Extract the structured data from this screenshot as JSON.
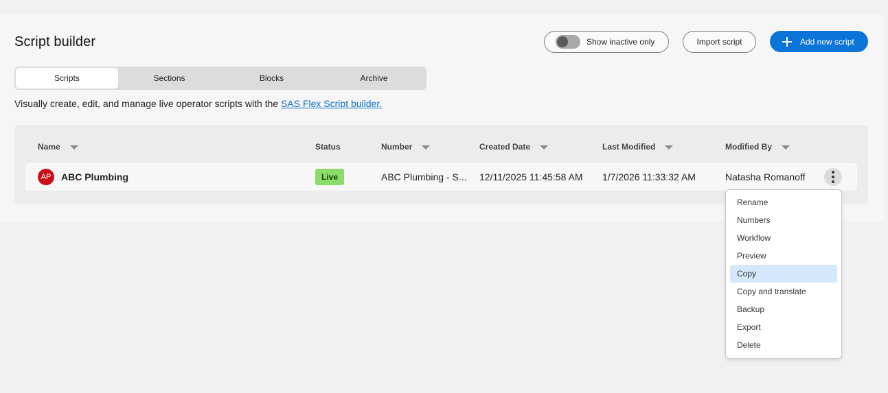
{
  "page": {
    "title": "Script builder",
    "description": "Visually create, edit, and manage live operator scripts with the ",
    "description_link": "SAS Flex Script builder."
  },
  "header": {
    "toggle_label": "Show inactive only",
    "toggle_on": false,
    "import_label": "Import script",
    "add_label": "Add new script"
  },
  "tabs": [
    {
      "label": "Scripts",
      "active": true
    },
    {
      "label": "Sections",
      "active": false
    },
    {
      "label": "Blocks",
      "active": false
    },
    {
      "label": "Archive",
      "active": false
    }
  ],
  "table": {
    "columns": [
      "Name",
      "Status",
      "Number",
      "Created Date",
      "Last Modified",
      "Modified By"
    ],
    "rows": [
      {
        "avatar": "AP",
        "name": "ABC Plumbing",
        "status": "Live",
        "number": "ABC Plumbing - S...",
        "created": "12/11/2025 11:45:58 AM",
        "modified": "1/7/2026 11:33:32 AM",
        "modified_by": "Natasha Romanoff"
      }
    ]
  },
  "context_menu": {
    "items": [
      "Rename",
      "Numbers",
      "Workflow",
      "Preview",
      "Copy",
      "Copy and translate",
      "Backup",
      "Export",
      "Delete"
    ],
    "highlighted": "Copy"
  },
  "colors": {
    "primary": "#0b74d8",
    "live_badge": "#8cdc6a",
    "avatar": "#c9111c",
    "menu_highlight": "#d5e8fb"
  }
}
